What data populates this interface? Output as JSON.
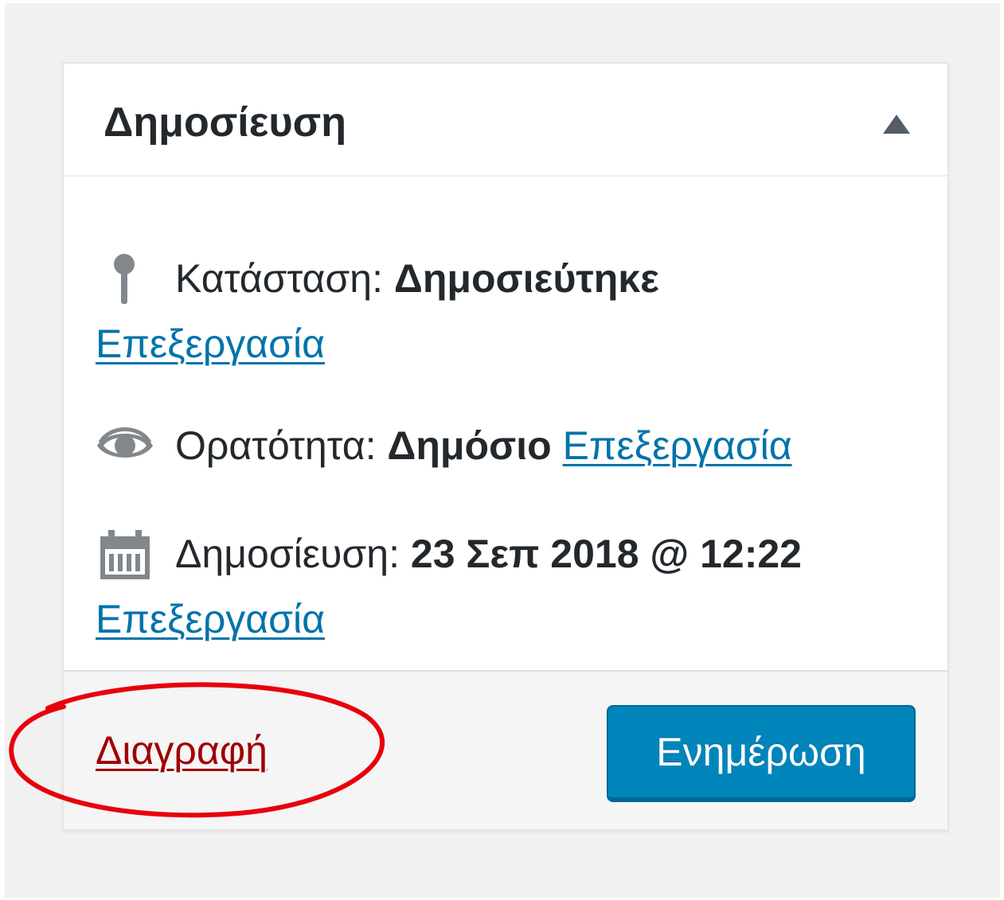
{
  "publish_box": {
    "title": "Δημοσίευση",
    "toggle_icon": "triangle-up-icon"
  },
  "status": {
    "icon": "pin-icon",
    "label": "Κατάσταση:",
    "value": "Δημοσιεύτηκε",
    "edit_link": "Επεξεργασία"
  },
  "visibility": {
    "icon": "eye-icon",
    "label": "Ορατότητα:",
    "value": "Δημόσιο",
    "edit_link": "Επεξεργασία"
  },
  "publish_date": {
    "icon": "calendar-icon",
    "label": "Δημοσίευση:",
    "value": "23 Σεπ 2018 @ 12:22",
    "edit_link": "Επεξεργασία"
  },
  "actions": {
    "delete_label": "Διαγραφή",
    "update_label": "Ενημέρωση"
  },
  "colors": {
    "link": "#0073aa",
    "delete": "#a00000",
    "primary_button": "#0085ba",
    "annotation": "#e8000b",
    "icon": "#82878c"
  }
}
